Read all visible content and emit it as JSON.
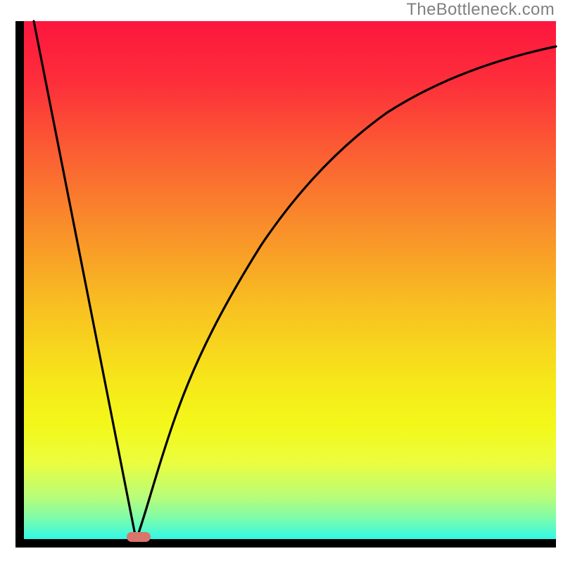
{
  "watermark": "TheBottleneck.com",
  "chart_data": {
    "type": "line",
    "title": "",
    "xlabel": "",
    "ylabel": "",
    "x_range": [
      0,
      100
    ],
    "y_range": [
      0,
      100
    ],
    "curve": {
      "description": "V-shaped bottleneck curve: steep linear descent from top-left to minimum at x≈21, then asymptotic rise toward top-right",
      "min_x": 21,
      "min_y": 0,
      "points": [
        {
          "x": 0,
          "y": 100
        },
        {
          "x": 21,
          "y": 0
        },
        {
          "x": 25,
          "y": 15
        },
        {
          "x": 30,
          "y": 32
        },
        {
          "x": 35,
          "y": 46
        },
        {
          "x": 40,
          "y": 56
        },
        {
          "x": 45,
          "y": 64
        },
        {
          "x": 50,
          "y": 70
        },
        {
          "x": 55,
          "y": 75
        },
        {
          "x": 60,
          "y": 79
        },
        {
          "x": 65,
          "y": 82.5
        },
        {
          "x": 70,
          "y": 85
        },
        {
          "x": 75,
          "y": 87
        },
        {
          "x": 80,
          "y": 88.5
        },
        {
          "x": 85,
          "y": 89.8
        },
        {
          "x": 90,
          "y": 90.8
        },
        {
          "x": 95,
          "y": 91.5
        },
        {
          "x": 100,
          "y": 92
        }
      ]
    },
    "marker": {
      "x": 21,
      "y": 0,
      "color": "#d9756b",
      "shape": "rounded-rect"
    },
    "background_gradient": {
      "stops": [
        {
          "offset": 0.0,
          "color": "#fd163e"
        },
        {
          "offset": 0.12,
          "color": "#fd2f3a"
        },
        {
          "offset": 0.25,
          "color": "#fb5d33"
        },
        {
          "offset": 0.4,
          "color": "#f98f2a"
        },
        {
          "offset": 0.55,
          "color": "#f8c021"
        },
        {
          "offset": 0.7,
          "color": "#f6e81a"
        },
        {
          "offset": 0.78,
          "color": "#f3f81a"
        },
        {
          "offset": 0.85,
          "color": "#ecfd3d"
        },
        {
          "offset": 0.92,
          "color": "#b7fd7a"
        },
        {
          "offset": 0.96,
          "color": "#7dfcab"
        },
        {
          "offset": 1.0,
          "color": "#31f9e7"
        }
      ]
    },
    "frame": {
      "outer_margin_left": 22,
      "outer_margin_right": 10,
      "outer_margin_top": 30,
      "outer_margin_bottom": 22,
      "inner_plot_x": 34,
      "inner_plot_y": 30,
      "inner_plot_w": 756,
      "inner_plot_h": 748
    }
  }
}
